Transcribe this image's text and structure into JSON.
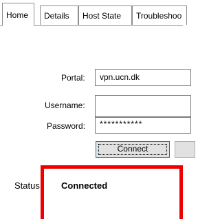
{
  "tabs": [
    {
      "label": "Home",
      "active": true
    },
    {
      "label": "Details",
      "active": false
    },
    {
      "label": "Host State",
      "active": false
    },
    {
      "label": "Troubleshoo",
      "active": false
    }
  ],
  "form": {
    "portal_label": "Portal:",
    "portal_value": "vpn.ucn.dk",
    "username_label": "Username:",
    "username_value": "",
    "password_label": "Password:",
    "password_value": "***********",
    "connect_label": "Connect"
  },
  "status": {
    "label": "Status:",
    "value": "Connected"
  },
  "colors": {
    "highlight": "#ee0000",
    "focus_border": "#0078d7"
  }
}
